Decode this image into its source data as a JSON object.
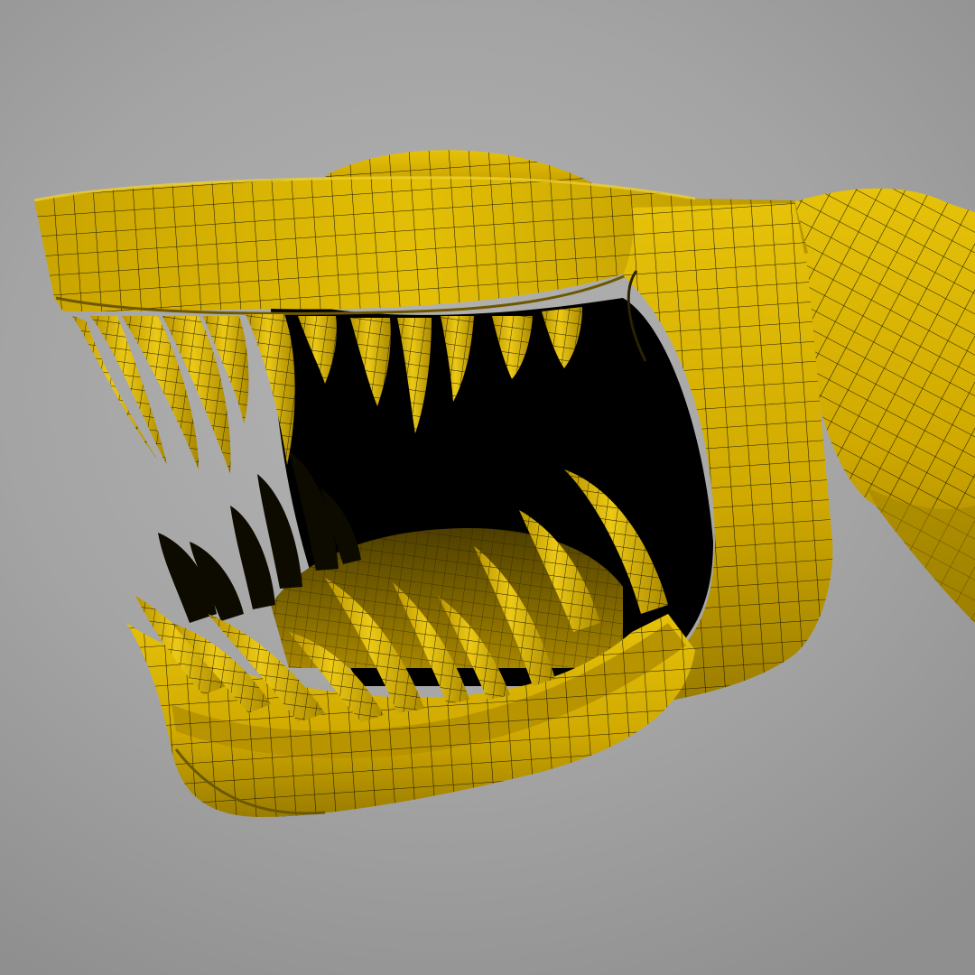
{
  "image": {
    "subject": "",
    "colors": {
      "background": "#a9a9a9",
      "mesh_fill": "#d9b400",
      "mesh_shadow": "#8a6f00",
      "wireframe": "#1e1800",
      "mouth_interior": "#000000"
    }
  }
}
